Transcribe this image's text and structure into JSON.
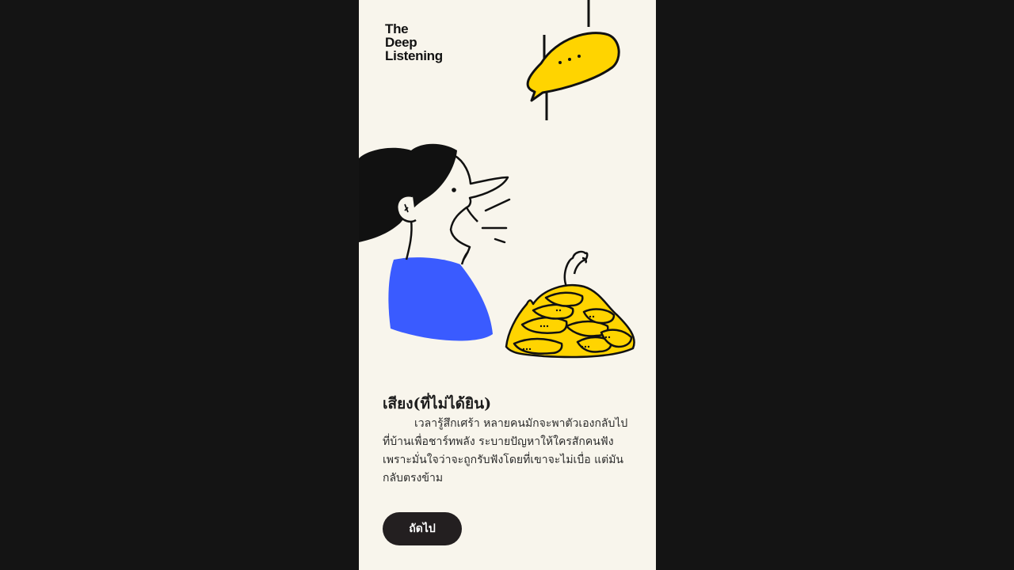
{
  "brand": {
    "logo_line1": "The",
    "logo_line2": "Deep",
    "logo_line3": "Listening"
  },
  "content": {
    "title": "เสียง(ที่ไม่ได้ยิน)",
    "paragraph": "เวลารู้สึกเศร้า หลายคนมักจะพาตัวเองกลับไปที่บ้านเพื่อชาร์ทพลัง ระบายปัญหาให้ใครสักคนฟัง เพราะมั่นใจว่าจะถูกรับฟังโดยที่เขาจะไม่เบื่อ แต่มันกลับตรงข้าม"
  },
  "actions": {
    "next_label": "ถัดไป"
  },
  "illustration": {
    "speech_bubble_text": "• • •"
  },
  "colors": {
    "page_background": "#141414",
    "card_background": "#f8f5ec",
    "accent_yellow": "#ffd400",
    "shirt_blue": "#3a5bff",
    "button_dark": "#231f20"
  }
}
